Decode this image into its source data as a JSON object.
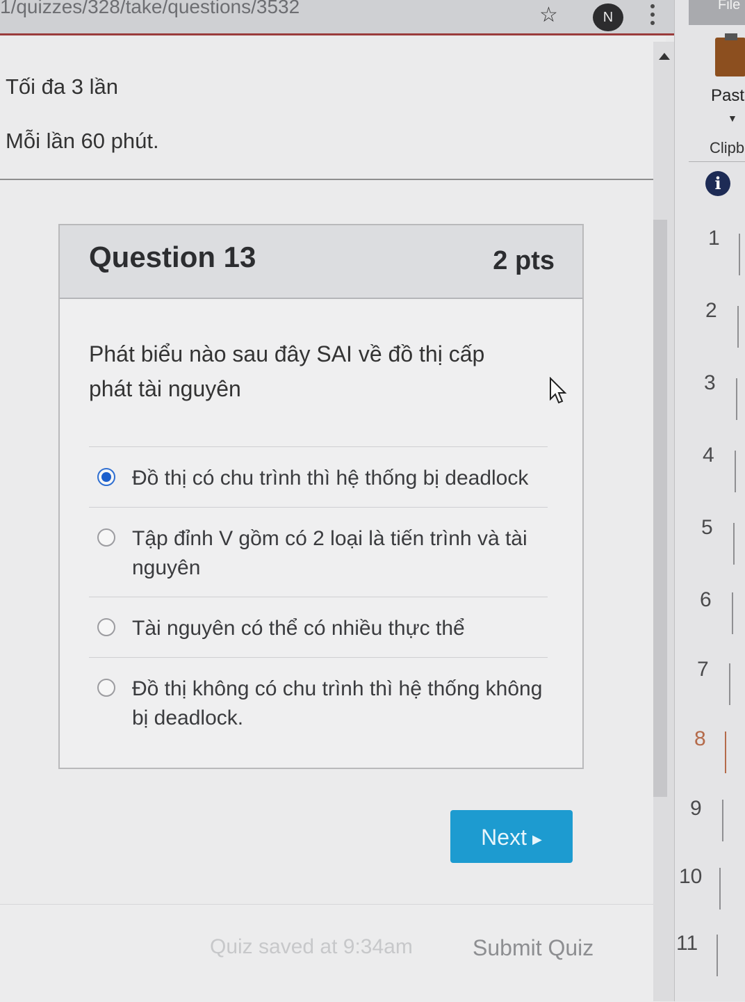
{
  "browser": {
    "url": "1/quizzes/328/take/questions/3532",
    "profile_initial": "N"
  },
  "quiz_meta": {
    "attempts": "Tối đa 3 lần",
    "time_limit": "Mỗi lần 60 phút."
  },
  "question": {
    "title": "Question 13",
    "points": "2 pts",
    "text": "Phát biểu nào sau đây SAI về đồ thị cấp phát tài nguyên",
    "answers": [
      {
        "label": "Đồ thị có chu trình thì hệ thống bị deadlock",
        "selected": true
      },
      {
        "label": "Tập đỉnh V gồm có 2 loại là tiến trình và tài nguyên",
        "selected": false
      },
      {
        "label": "Tài nguyên có thể có nhiều thực thể",
        "selected": false
      },
      {
        "label": "Đồ thị không có chu trình thì hệ thống không bị deadlock.",
        "selected": false
      }
    ]
  },
  "actions": {
    "next_label": "Next",
    "saved_status": "Quiz saved at 9:34am",
    "submit_label": "Submit Quiz"
  },
  "side_panel": {
    "top_label": "File",
    "paste_label": "Paste",
    "clipboard_label": "Clipb",
    "line_numbers": [
      "1",
      "2",
      "3",
      "4",
      "5",
      "6",
      "7",
      "8",
      "9",
      "10",
      "11"
    ]
  }
}
